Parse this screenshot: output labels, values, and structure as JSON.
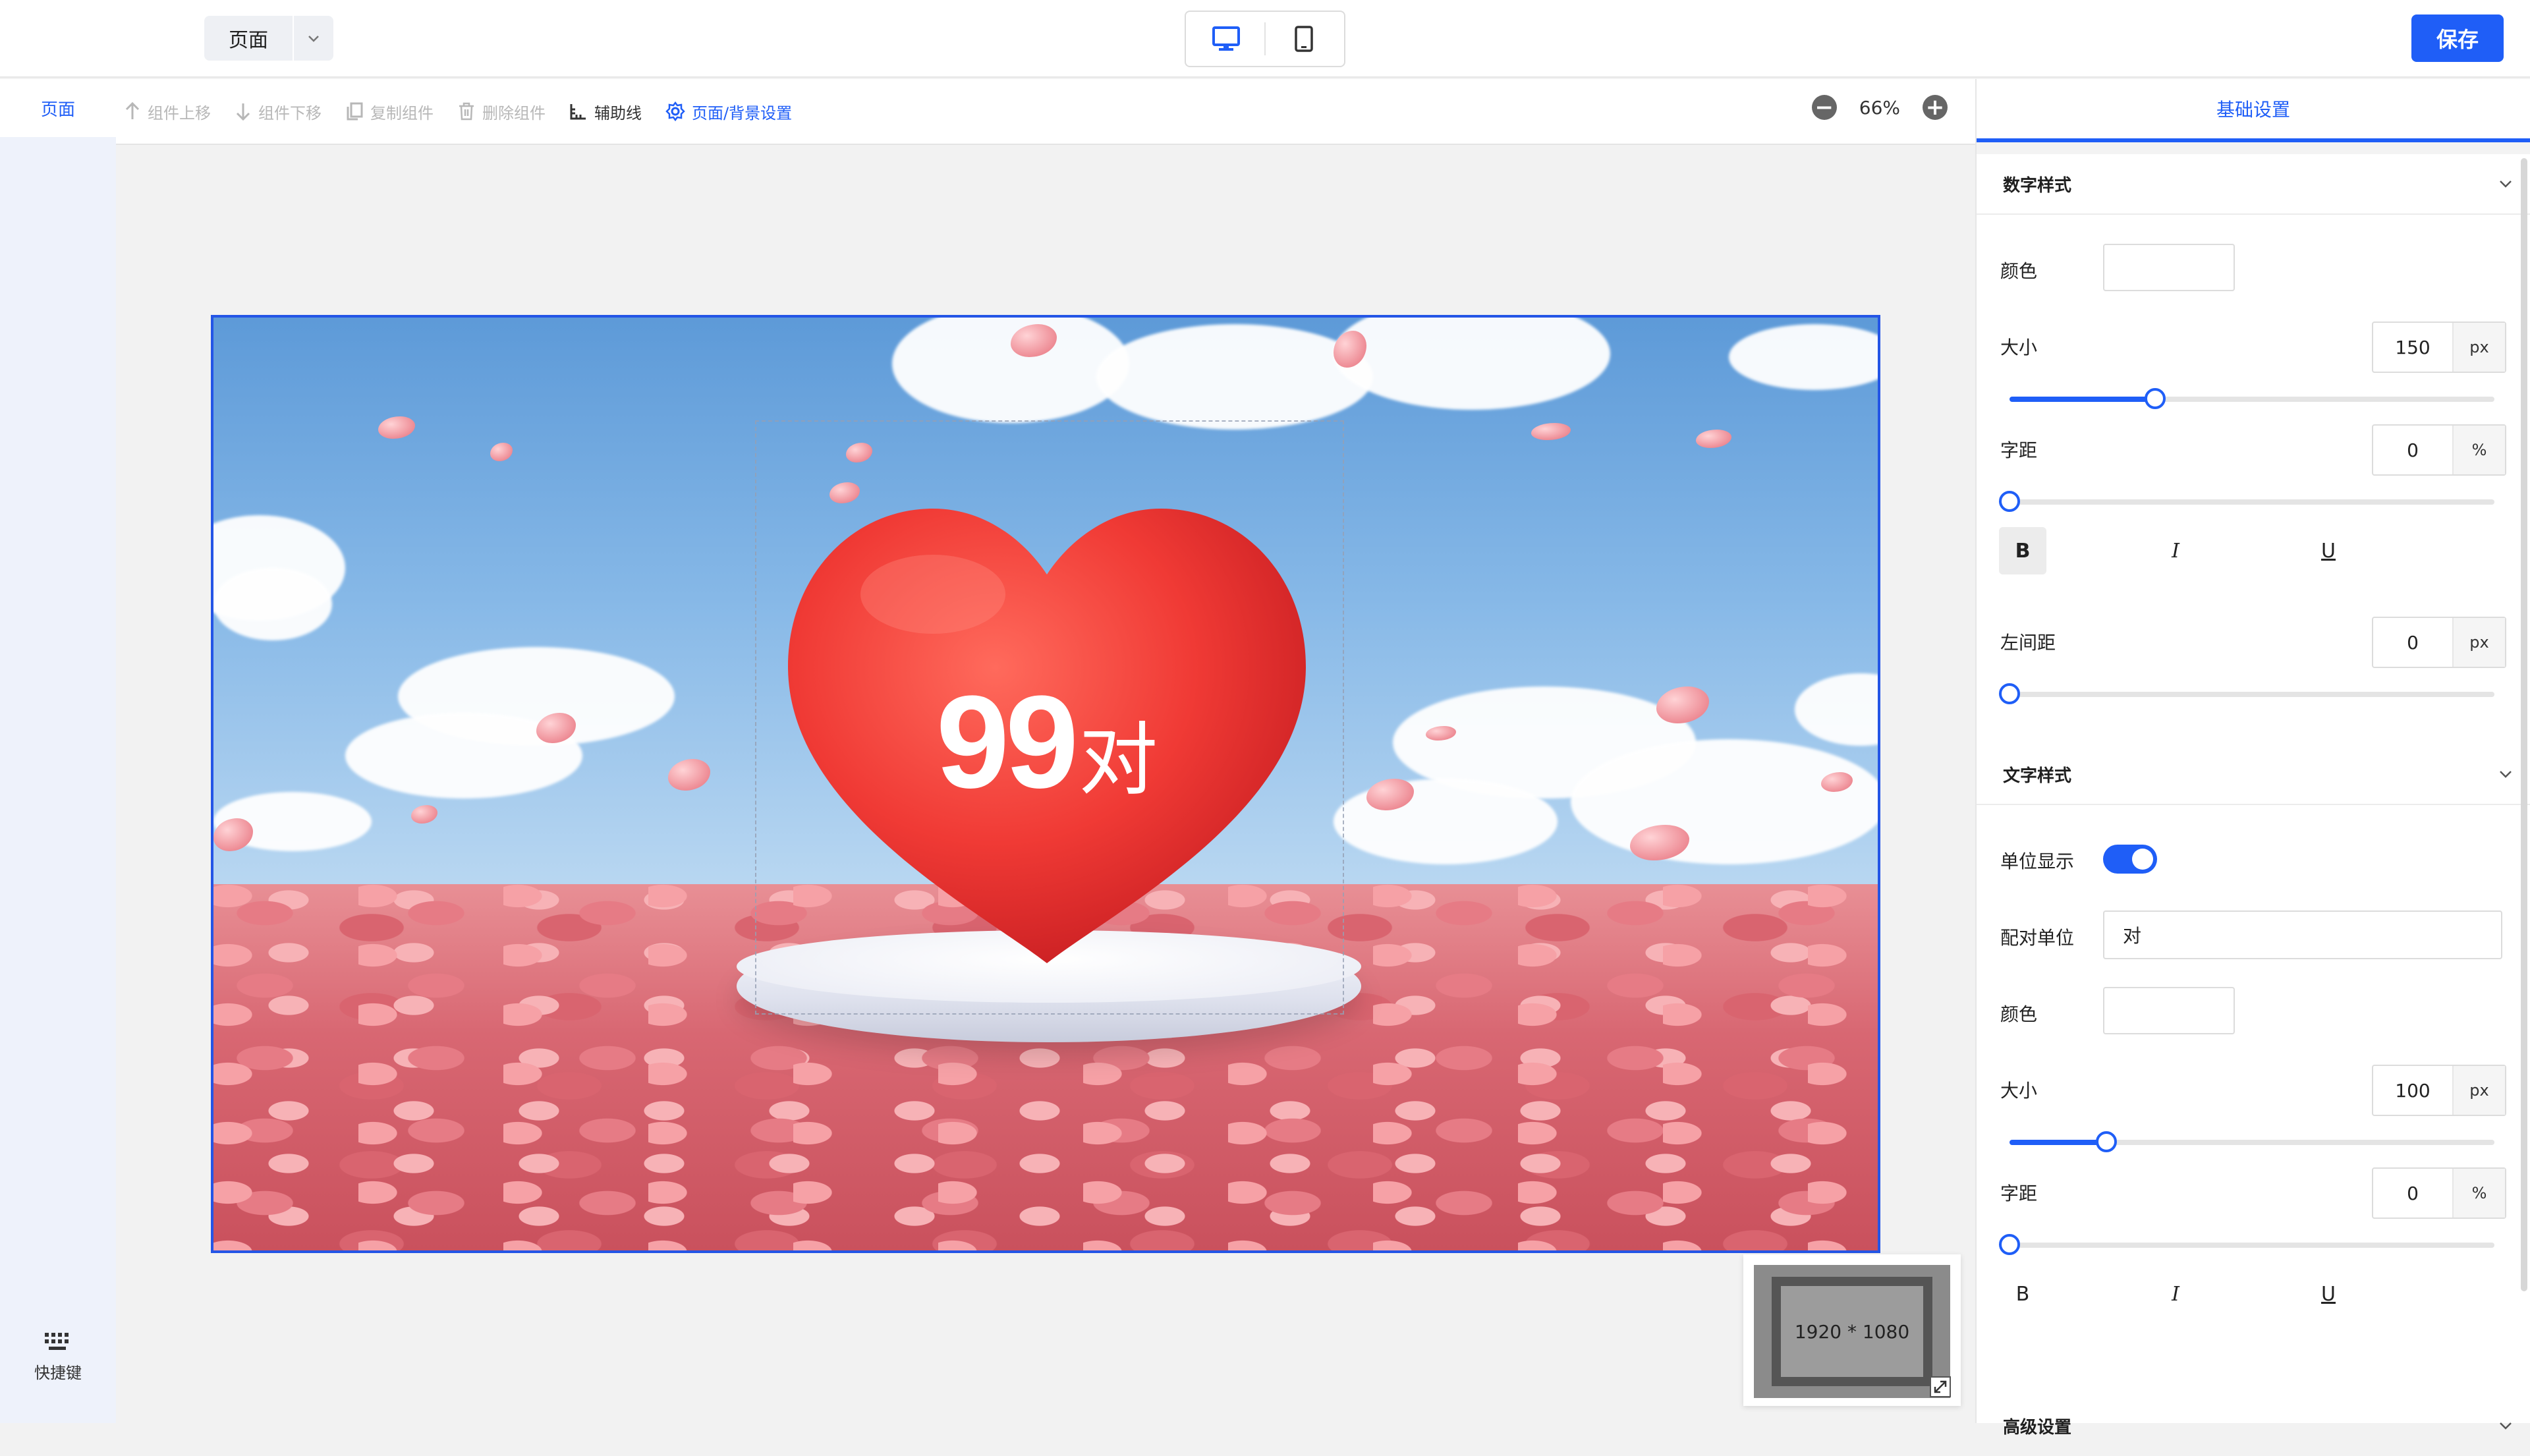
{
  "topbar": {
    "page_select_label": "页面",
    "save_label": "保存"
  },
  "leftrail": {
    "tab_label": "页面",
    "shortcut_label": "快捷键"
  },
  "toolbar": {
    "items": [
      {
        "label": "组件上移",
        "state": "disabled"
      },
      {
        "label": "组件下移",
        "state": "disabled"
      },
      {
        "label": "复制组件",
        "state": "disabled"
      },
      {
        "label": "删除组件",
        "state": "disabled"
      },
      {
        "label": "辅助线",
        "state": "normal"
      },
      {
        "label": "页面/背景设置",
        "state": "active"
      }
    ],
    "zoom_value": "66%"
  },
  "canvas": {
    "number_text": "99",
    "unit_text": "对",
    "minimap_label": "1920 * 1080"
  },
  "panel": {
    "tab_label": "基础设置",
    "number_style": {
      "title": "数字样式",
      "color_label": "颜色",
      "size_label": "大小",
      "size_value": "150",
      "size_unit": "px",
      "size_fraction": 0.3,
      "spacing_label": "字距",
      "spacing_value": "0",
      "spacing_unit": "%",
      "spacing_fraction": 0,
      "bold": "B",
      "italic": "I",
      "underline": "U",
      "left_margin_label": "左间距",
      "left_margin_value": "0",
      "left_margin_unit": "px",
      "left_margin_fraction": 0
    },
    "text_style": {
      "title": "文字样式",
      "unit_display_label": "单位显示",
      "unit_display_on": true,
      "pair_unit_label": "配对单位",
      "pair_unit_value": "对",
      "color_label": "颜色",
      "size_label": "大小",
      "size_value": "100",
      "size_unit": "px",
      "size_fraction": 0.2,
      "spacing_label": "字距",
      "spacing_value": "0",
      "spacing_unit": "%",
      "spacing_fraction": 0,
      "bold": "B",
      "italic": "I",
      "underline": "U"
    },
    "advanced_title": "高级设置"
  },
  "colors": {
    "accent": "#1f5ef7",
    "heart": "#f03a35"
  }
}
